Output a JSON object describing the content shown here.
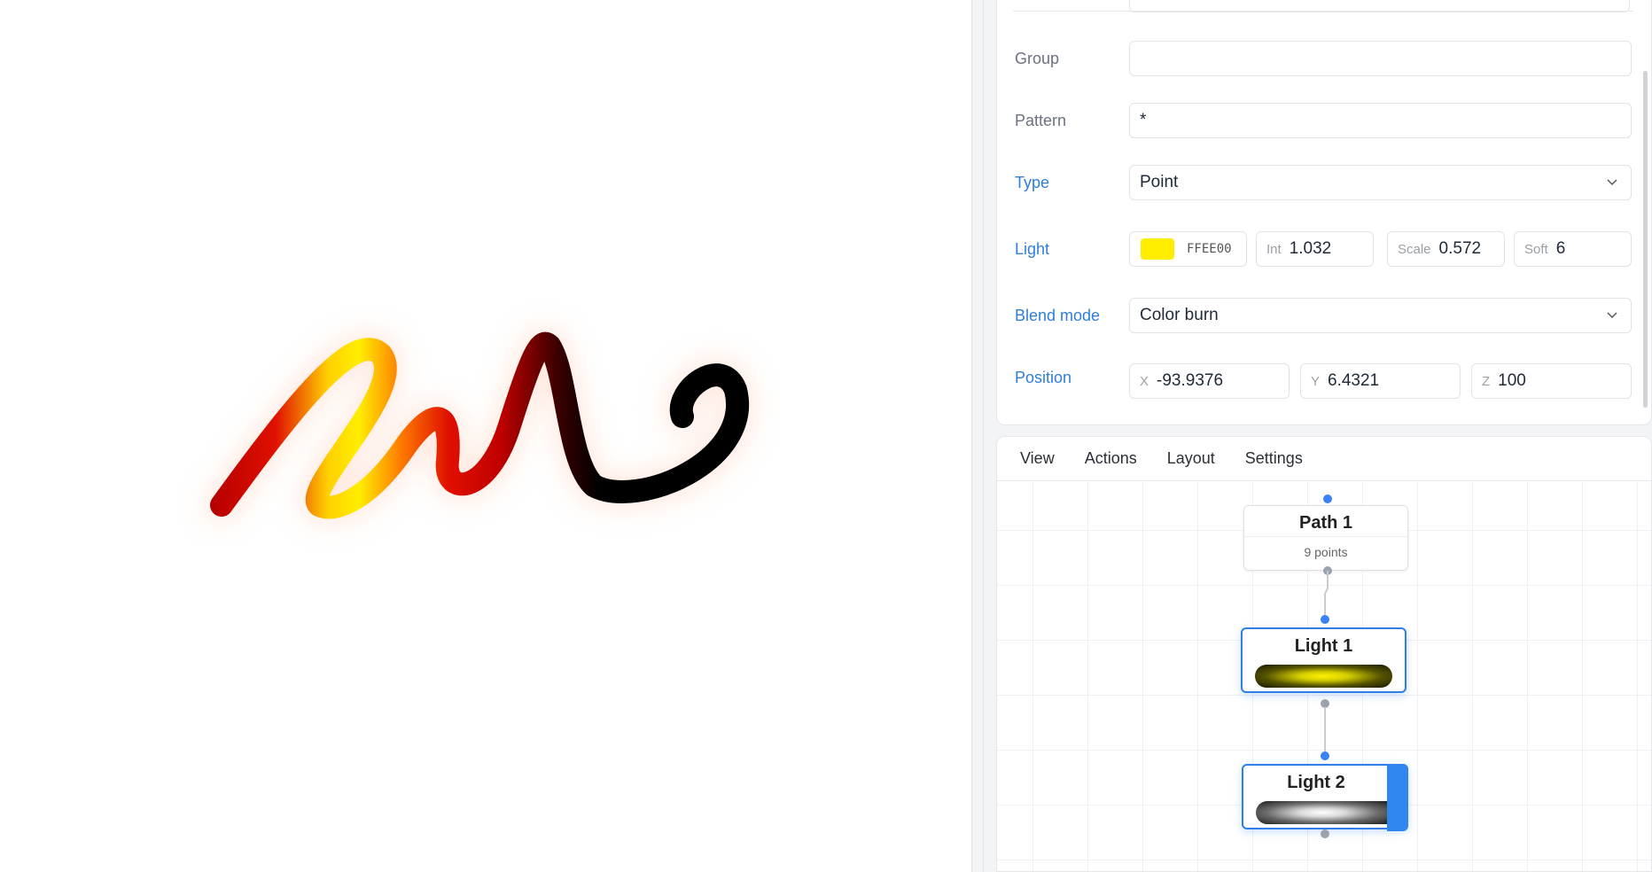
{
  "properties": {
    "group": {
      "label": "Group",
      "value": ""
    },
    "pattern": {
      "label": "Pattern",
      "value": "*"
    },
    "type": {
      "label": "Type",
      "value": "Point"
    },
    "light": {
      "label": "Light",
      "color_hex": "FFEE00",
      "color": "#FFEE00",
      "intensity": {
        "prefix": "Int",
        "value": "1.032"
      },
      "scale": {
        "prefix": "Scale",
        "value": "0.572"
      },
      "softness": {
        "prefix": "Soft",
        "value": "6"
      }
    },
    "blend_mode": {
      "label": "Blend mode",
      "value": "Color burn"
    },
    "position": {
      "label": "Position",
      "x": {
        "prefix": "X",
        "value": "-93.9376"
      },
      "y": {
        "prefix": "Y",
        "value": "6.4321"
      },
      "z": {
        "prefix": "Z",
        "value": "100"
      }
    }
  },
  "graph": {
    "tabs": [
      "View",
      "Actions",
      "Layout",
      "Settings"
    ],
    "nodes": [
      {
        "title": "Path 1",
        "subtitle": "9 points"
      },
      {
        "title": "Light 1",
        "preview_color": "#F5EB00"
      },
      {
        "title": "Light 2",
        "preview_color": "#FFFFFF"
      }
    ]
  },
  "colors": {
    "accent": "#2F7FE6",
    "label_blue": "#2F7FD8"
  }
}
